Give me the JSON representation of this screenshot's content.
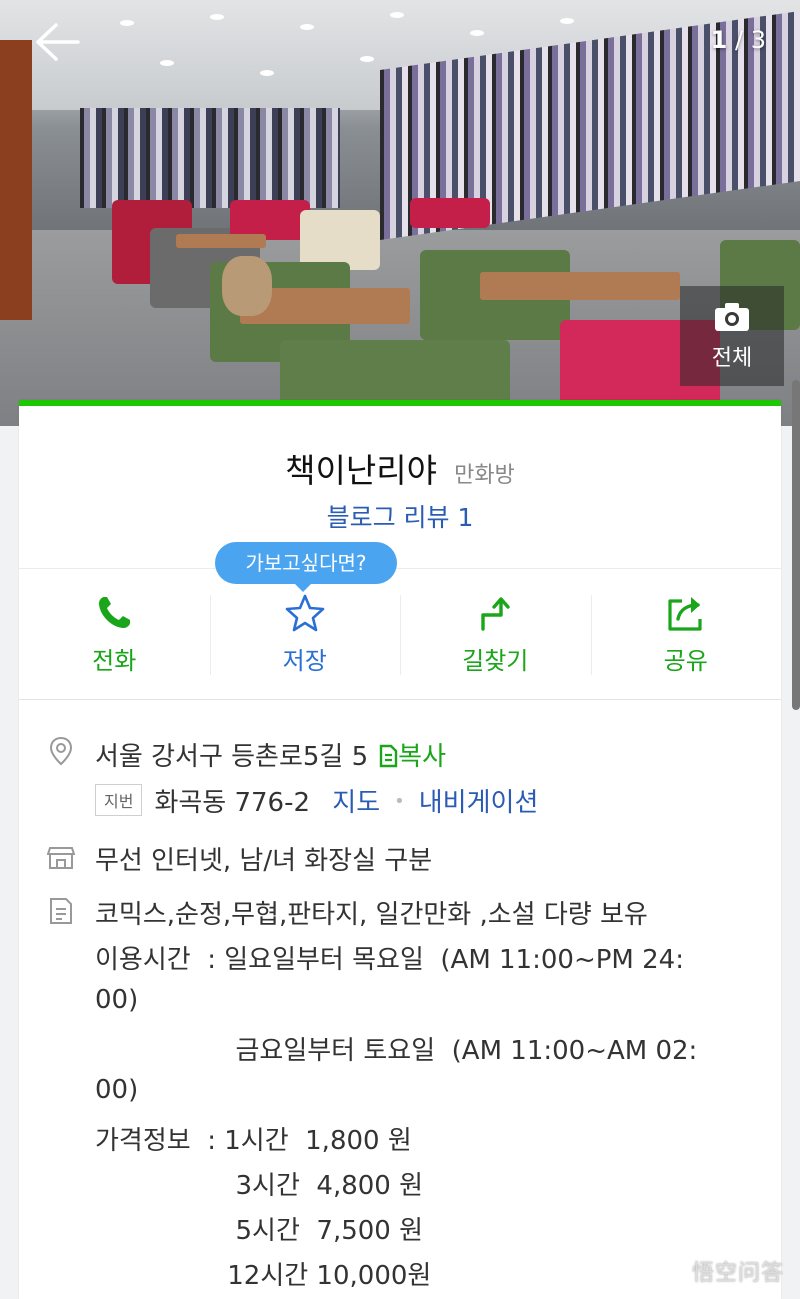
{
  "photo": {
    "counter_current": "1",
    "counter_sep": "/",
    "counter_total": "3",
    "all_label": "전체"
  },
  "place": {
    "name": "책이난리야",
    "category": "만화방",
    "review_label": "블로그 리뷰 1"
  },
  "tooltip": "가보고싶다면?",
  "actions": [
    {
      "label": "전화",
      "icon": "phone-icon"
    },
    {
      "label": "저장",
      "icon": "star-icon"
    },
    {
      "label": "길찾기",
      "icon": "directions-icon"
    },
    {
      "label": "공유",
      "icon": "share-icon"
    }
  ],
  "address": {
    "road": "서울 강서구 등촌로5길 5",
    "copy_label": "복사",
    "jibun_tag": "지번",
    "jibun": "화곡동 776-2",
    "map_link": "지도",
    "nav_link": "내비게이션"
  },
  "facilities": "무선 인터넷, 남/녀 화장실 구분",
  "description_lines": [
    "코믹스,순정,무협,판타지, 일간만화 ,소설 다량 보유",
    "이용시간  : 일요일부터 목요일  (AM 11:00~PM 24:",
    "00)",
    "                 금요일부터 토요일  (AM 11:00~AM 02:",
    "00)",
    "가격정보  : 1시간  1,800 원",
    "                 3시간  4,800 원",
    "                 5시간  7,500 원",
    "                12시간 10,000원"
  ],
  "watermark": "悟空问答",
  "colors": {
    "brand_green": "#1ec800",
    "action_green": "#1aa51a",
    "link_blue": "#2a5cb4",
    "tooltip_blue": "#4aa4f0"
  }
}
